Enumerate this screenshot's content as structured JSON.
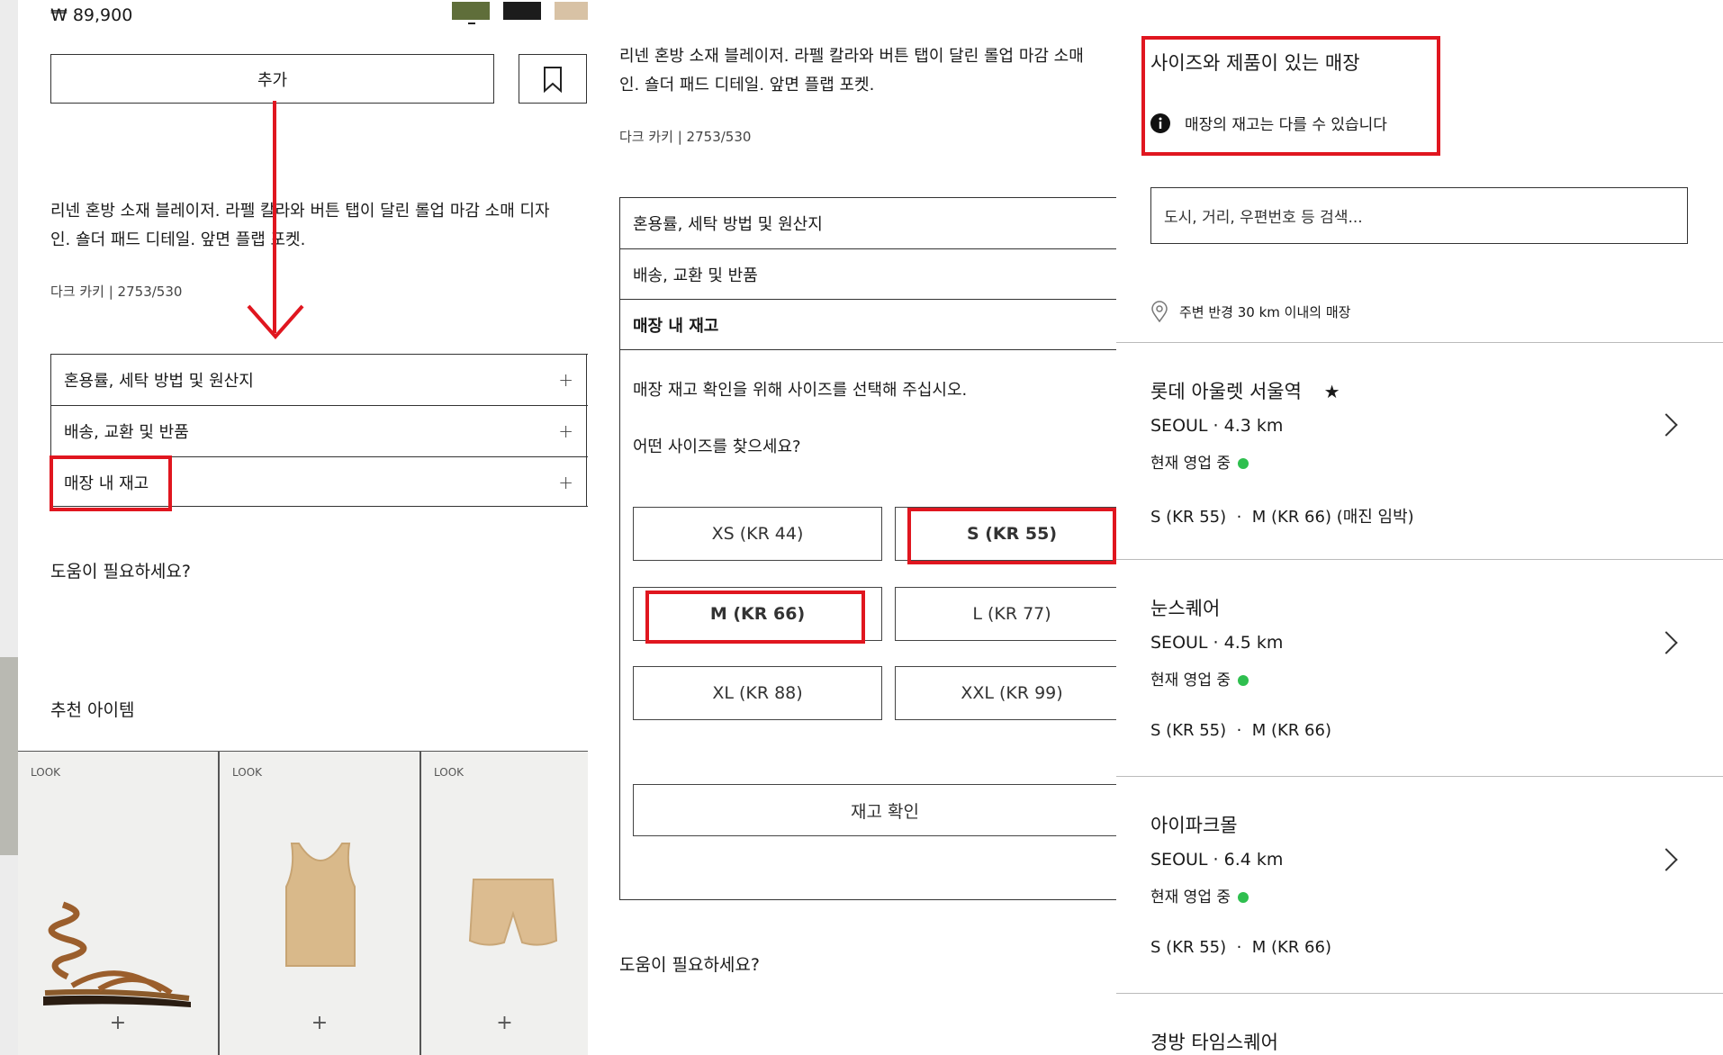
{
  "left": {
    "price": "₩ 89,900",
    "swatches": [
      "#5f6e3a",
      "#1c1c1c",
      "#d8c2a5"
    ],
    "add_button": "추가",
    "description": [
      "리넨 혼방 소재 블레이저. 라펠 칼라와 버튼 탭이 달린 롤업 마감 소매 디자",
      "인. 숄더 패드 디테일. 앞면 플랩 포켓."
    ],
    "color_code": "다크 카키 | 2753/530",
    "accordion": [
      "혼용률, 세탁 방법 및 원산지",
      "배송, 교환 및 반품",
      "매장 내 재고"
    ],
    "plus_glyph": "+",
    "help": "도움이 필요하세요?",
    "recommended": "추천 아이템",
    "cards": [
      {
        "label": "LOOK",
        "icon": "sandal-icon"
      },
      {
        "label": "LOOK",
        "icon": "tank-top-icon"
      },
      {
        "label": "LOOK",
        "icon": "shorts-icon"
      }
    ]
  },
  "middle": {
    "description": [
      "리넨 혼방 소재 블레이저. 라펠 칼라와 버튼 탭이 달린 롤업 마감 소매",
      "인. 숄더 패드 디테일. 앞면 플랩 포켓."
    ],
    "color_code": "다크 카키 | 2753/530",
    "accordion": [
      "혼용률, 세탁 방법 및 원산지",
      "배송, 교환 및 반품",
      "매장 내 재고"
    ],
    "instruction": "매장 재고 확인을 위해 사이즈를 선택해 주십시오.",
    "question": "어떤 사이즈를 찾으세요?",
    "sizes": [
      "XS (KR 44)",
      "S (KR 55)",
      "M (KR 66)",
      "L (KR 77)",
      "XL (KR 88)",
      "XXL (KR 99)"
    ],
    "check_button": "재고 확인",
    "help": "도움이 필요하세요?"
  },
  "right": {
    "title": "사이즈와 제품이 있는 매장",
    "notice": "매장의 재고는 다를 수 있습니다",
    "search_placeholder": "도시, 거리, 우편번호 등 검색...",
    "radius": "주변 반경 30 km 이내의 매장",
    "open_label": "현재 영업 중",
    "stores": [
      {
        "name": "롯데 아울렛 서울역",
        "star": "★",
        "city": "SEOUL · 4.3 km",
        "sizes": "S (KR 55)  ·  M (KR 66) (매진 임박)"
      },
      {
        "name": "눈스퀘어",
        "star": "",
        "city": "SEOUL · 4.5 km",
        "sizes": "S (KR 55)  ·  M (KR 66)"
      },
      {
        "name": "아이파크몰",
        "star": "",
        "city": "SEOUL · 6.4 km",
        "sizes": "S (KR 55)  ·  M (KR 66)"
      },
      {
        "name": "경방 타임스퀘어",
        "star": "",
        "city": "",
        "sizes": ""
      }
    ]
  }
}
